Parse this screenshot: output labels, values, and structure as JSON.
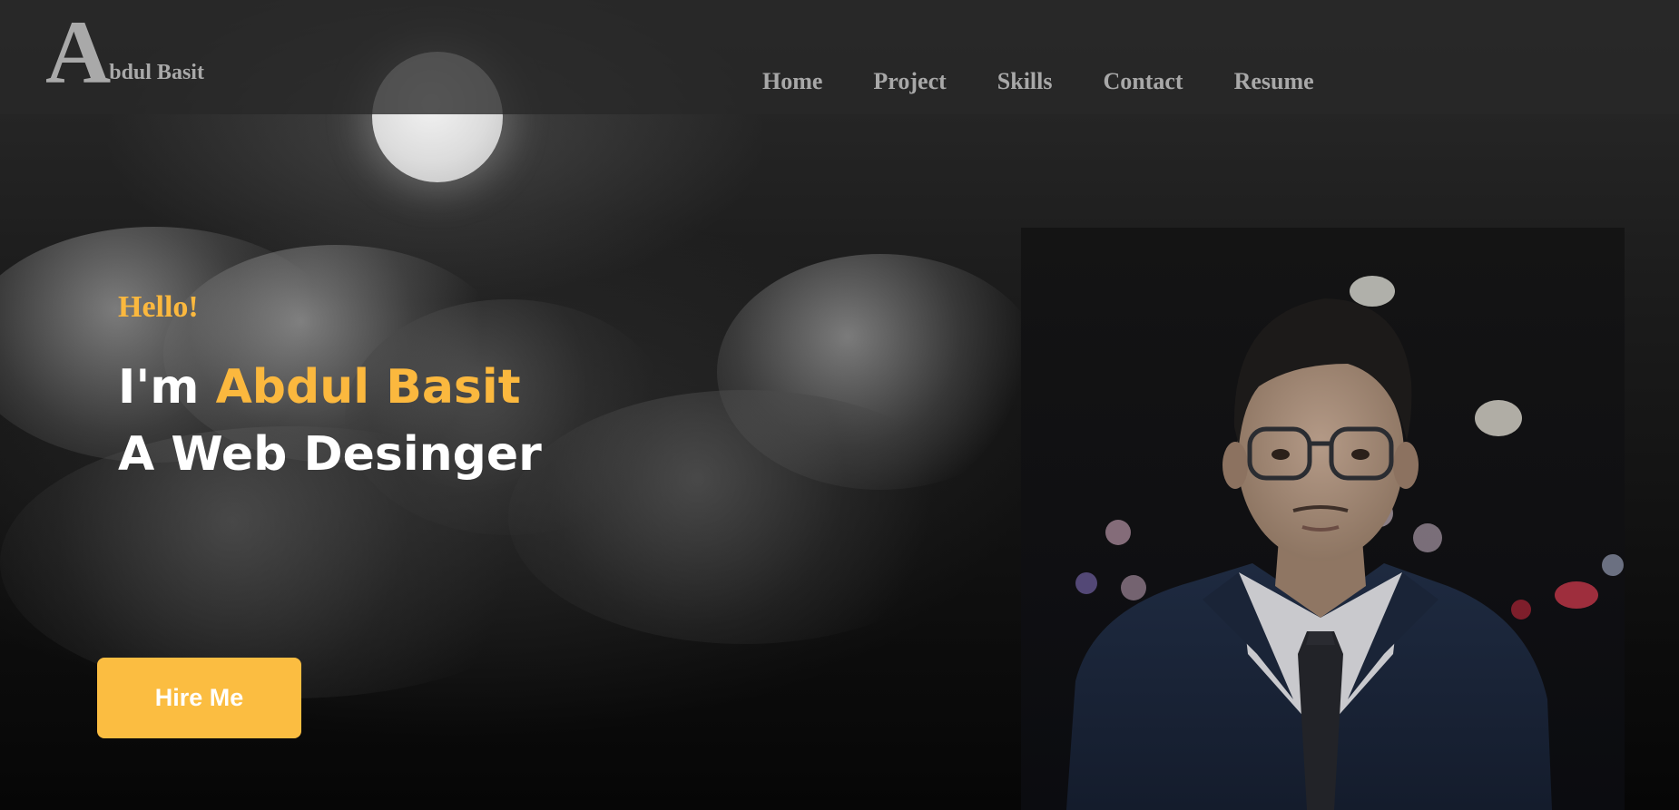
{
  "header": {
    "logo": {
      "letter": "A",
      "rest": "bdul Basit"
    },
    "nav": [
      {
        "label": "Home"
      },
      {
        "label": "Project"
      },
      {
        "label": "Skills"
      },
      {
        "label": "Contact"
      },
      {
        "label": "Resume"
      }
    ]
  },
  "hero": {
    "greeting": "Hello!",
    "line1_prefix": "I'm ",
    "line1_name": "Abdul Basit",
    "line2": "A Web Desinger",
    "cta_label": "Hire Me"
  },
  "colors": {
    "accent": "#fbb83e",
    "button": "#fbbd41",
    "nav_text": "#a8a8a8",
    "topbar": "#282828"
  },
  "icons": {
    "logo": "monogram-A",
    "background": "moonlit-clouds",
    "portrait": "person-portrait"
  }
}
